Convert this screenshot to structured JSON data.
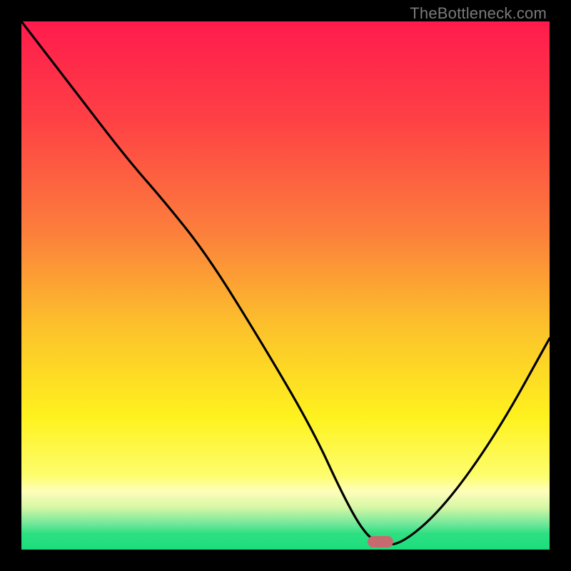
{
  "watermark": "TheBottleneck.com",
  "chart_data": {
    "type": "line",
    "title": "",
    "xlabel": "",
    "ylabel": "",
    "xlim": [
      0,
      100
    ],
    "ylim": [
      0,
      100
    ],
    "grid": false,
    "series": [
      {
        "name": "bottleneck-curve",
        "x": [
          0,
          10,
          20,
          27,
          35,
          45,
          55,
          61,
          65,
          68,
          72,
          80,
          90,
          100
        ],
        "y": [
          100,
          87,
          74,
          66,
          56,
          40,
          23,
          10,
          3,
          1,
          1,
          8,
          22,
          40
        ]
      }
    ],
    "marker": {
      "x": 68,
      "y": 1,
      "label": "optimal-point"
    },
    "background_gradient": {
      "stops": [
        {
          "pct": 0,
          "color": "#ff1b4d"
        },
        {
          "pct": 18,
          "color": "#fe3f45"
        },
        {
          "pct": 40,
          "color": "#fc7f3c"
        },
        {
          "pct": 58,
          "color": "#fcc22b"
        },
        {
          "pct": 75,
          "color": "#fef21e"
        },
        {
          "pct": 86,
          "color": "#fdfd6e"
        },
        {
          "pct": 89,
          "color": "#fefebb"
        },
        {
          "pct": 92,
          "color": "#d6f7a5"
        },
        {
          "pct": 95,
          "color": "#76e89b"
        },
        {
          "pct": 97,
          "color": "#2de082"
        },
        {
          "pct": 100,
          "color": "#1bdd7d"
        }
      ]
    }
  }
}
